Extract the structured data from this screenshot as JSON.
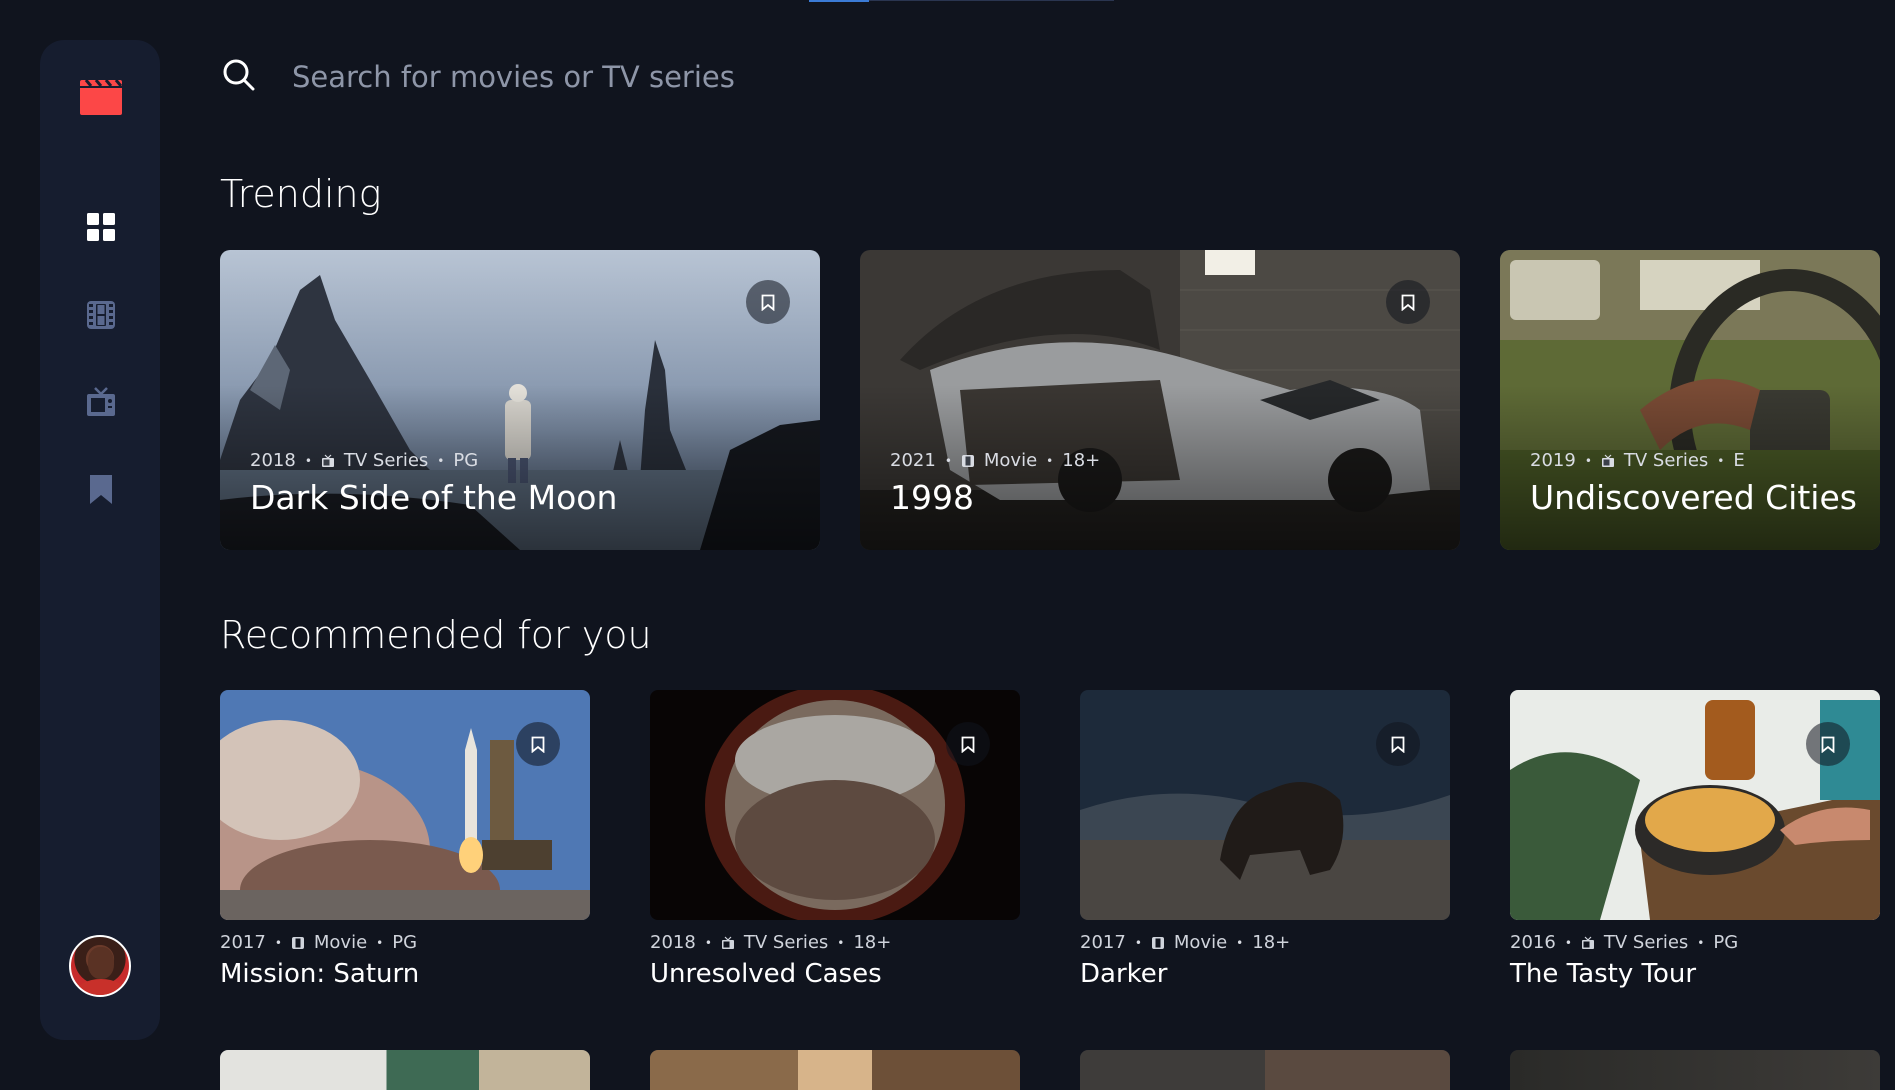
{
  "search": {
    "placeholder": "Search for movies or TV series"
  },
  "sections": {
    "trending": "Trending",
    "recommended": "Recommended for you"
  },
  "colors": {
    "background": "#10141e",
    "sidebar": "#161d2f",
    "accent": "#fc4747",
    "muted": "#5a698f"
  },
  "nav": {
    "icons": [
      "clapperboard-logo-icon",
      "home-grid-icon",
      "film-icon",
      "tv-icon",
      "bookmark-icon"
    ],
    "active": "home-grid-icon"
  },
  "trending": [
    {
      "year": "2018",
      "category": "TV Series",
      "rating": "PG",
      "title": "Dark Side of the Moon"
    },
    {
      "year": "2021",
      "category": "Movie",
      "rating": "18+",
      "title": "1998"
    },
    {
      "year": "2019",
      "category": "TV Series",
      "rating": "E",
      "title": "Undiscovered Cities"
    }
  ],
  "recommended": [
    {
      "year": "2017",
      "category": "Movie",
      "rating": "PG",
      "title": "Mission: Saturn"
    },
    {
      "year": "2018",
      "category": "TV Series",
      "rating": "18+",
      "title": "Unresolved Cases"
    },
    {
      "year": "2017",
      "category": "Movie",
      "rating": "18+",
      "title": "Darker"
    },
    {
      "year": "2016",
      "category": "TV Series",
      "rating": "PG",
      "title": "The Tasty Tour"
    }
  ],
  "meta_separator": "•"
}
